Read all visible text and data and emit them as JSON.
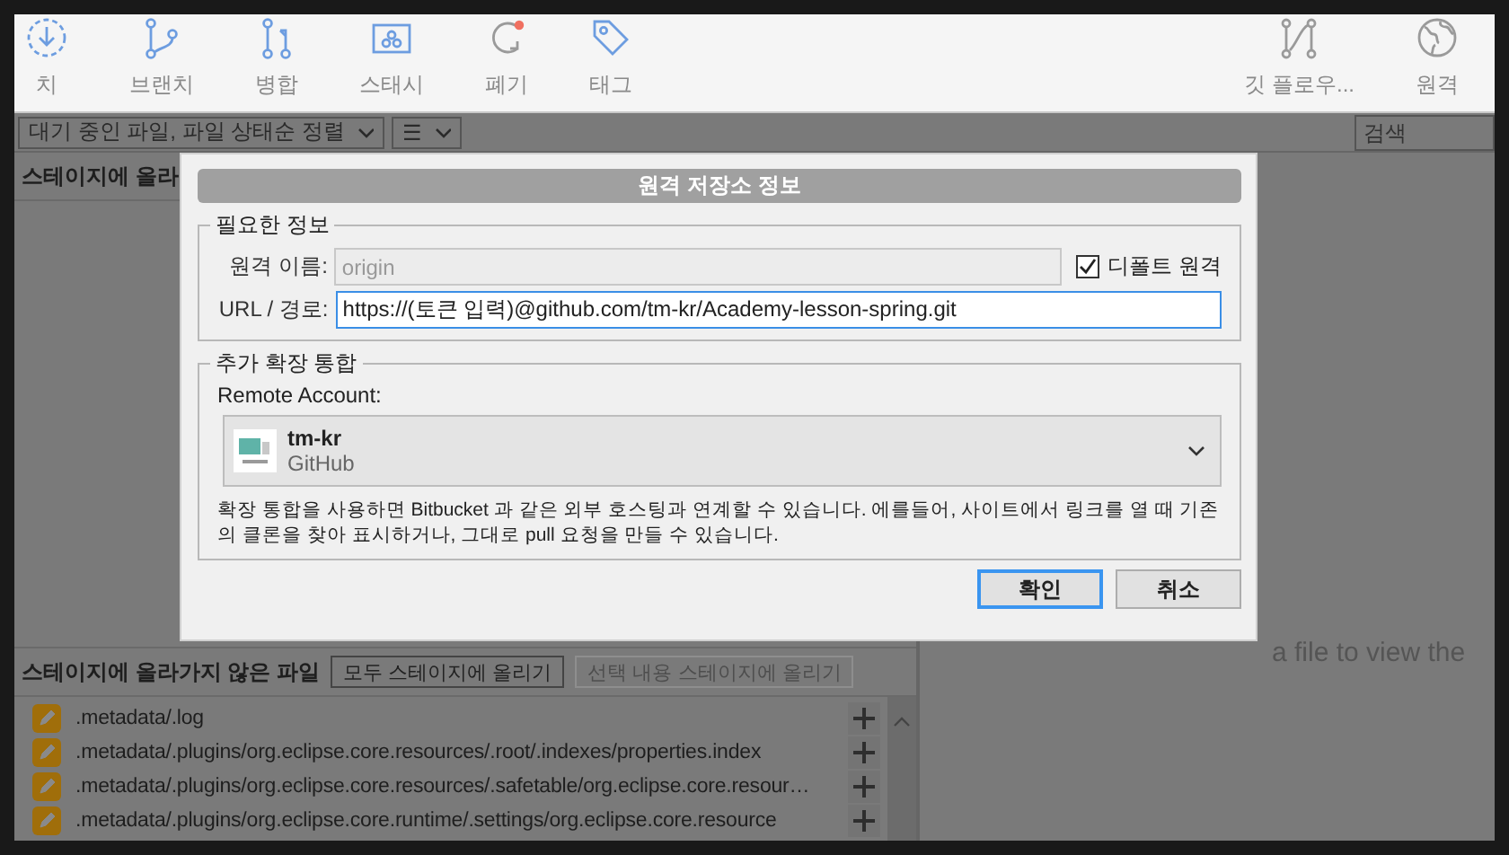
{
  "toolbar": {
    "left": [
      {
        "label": "치",
        "kind": "fetch"
      },
      {
        "label": "브랜치",
        "kind": "branch"
      },
      {
        "label": "병합",
        "kind": "merge"
      },
      {
        "label": "스태시",
        "kind": "stash"
      },
      {
        "label": "폐기",
        "kind": "discard"
      },
      {
        "label": "태그",
        "kind": "tag"
      }
    ],
    "right": [
      {
        "label": "깃 플로우...",
        "kind": "flow"
      },
      {
        "label": "원격",
        "kind": "remote"
      }
    ]
  },
  "filter_bar": {
    "sort_dropdown": "대기 중인 파일, 파일 상태순 정렬",
    "view_dropdown": "☰",
    "search": {
      "placeholder": "검색"
    }
  },
  "staged_panel": {
    "title": "스테이지에 올라"
  },
  "unstaged_panel": {
    "title": "스테이지에 올라가지 않은 파일",
    "buttons": [
      {
        "label": "모두 스테이지에 올리기",
        "disabled": false
      },
      {
        "label": "선택 내용 스테이지에 올리기",
        "disabled": true
      }
    ],
    "files": [
      {
        "path": ".metadata/.log"
      },
      {
        "path": ".metadata/.plugins/org.eclipse.core.resources/.root/.indexes/properties.index"
      },
      {
        "path": ".metadata/.plugins/org.eclipse.core.resources/.safetable/org.eclipse.core.resour…"
      },
      {
        "path": ".metadata/.plugins/org.eclipse.core.runtime/.settings/org.eclipse.core.resource"
      }
    ]
  },
  "diff_panel": {
    "hint": "a file to view the"
  },
  "dialog": {
    "title": "원격 저장소 정보",
    "required_group": {
      "legend": "필요한 정보",
      "name_label": "원격 이름:",
      "name_field": {
        "value": "origin",
        "disabled": true
      },
      "default_remote": {
        "label": "디폴트 원격",
        "checked": true
      },
      "url_label": "URL / 경로:",
      "url_field": {
        "value": "https://(토큰 입력)@github.com/tm-kr/Academy-lesson-spring.git"
      }
    },
    "integration_group": {
      "legend": "추가 확장 통합",
      "account_label": "Remote Account:",
      "account": {
        "name": "tm-kr",
        "host": "GitHub"
      },
      "description": "확장 통합을 사용하면 Bitbucket 과 같은 외부 호스팅과 연계할 수 있습니다. 에를들어, 사이트에서 링크를 열 때 기존의 클론을 찾아 표시하거나, 그대로 pull 요청을 만들 수 있습니다."
    },
    "buttons": [
      {
        "label": "확인",
        "kind": "primary"
      },
      {
        "label": "취소",
        "kind": "secondary"
      }
    ]
  }
}
